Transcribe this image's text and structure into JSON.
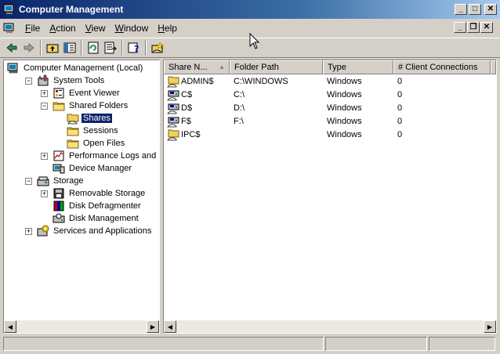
{
  "window": {
    "title": "Computer Management",
    "buttons": {
      "minimize": "_",
      "maximize": "□",
      "close": "✕"
    },
    "mdi_buttons": {
      "minimize": "_",
      "restore": "❐",
      "close": "✕"
    }
  },
  "menu": [
    {
      "label": "File",
      "key": "F",
      "rest": "ile"
    },
    {
      "label": "Action",
      "key": "A",
      "rest": "ction"
    },
    {
      "label": "View",
      "key": "V",
      "rest": "iew"
    },
    {
      "label": "Window",
      "key": "W",
      "rest": "indow"
    },
    {
      "label": "Help",
      "key": "H",
      "rest": "elp"
    }
  ],
  "tree": [
    {
      "label": "Computer Management (Local)",
      "icon": "computer-icon",
      "level": 0,
      "expander": ""
    },
    {
      "label": "System Tools",
      "icon": "system-tools-icon",
      "level": 1,
      "expander": "−"
    },
    {
      "label": "Event Viewer",
      "icon": "event-viewer-icon",
      "level": 2,
      "expander": "+"
    },
    {
      "label": "Shared Folders",
      "icon": "folder-icon",
      "level": 2,
      "expander": "−"
    },
    {
      "label": "Shares",
      "icon": "shares-icon",
      "level": 3,
      "expander": "",
      "selected": true
    },
    {
      "label": "Sessions",
      "icon": "folder-icon",
      "level": 3,
      "expander": ""
    },
    {
      "label": "Open Files",
      "icon": "folder-icon",
      "level": 3,
      "expander": ""
    },
    {
      "label": "Performance Logs and Alerts",
      "icon": "performance-icon",
      "level": 2,
      "expander": "+"
    },
    {
      "label": "Device Manager",
      "icon": "device-manager-icon",
      "level": 2,
      "expander": ""
    },
    {
      "label": "Storage",
      "icon": "storage-icon",
      "level": 1,
      "expander": "−"
    },
    {
      "label": "Removable Storage",
      "icon": "removable-storage-icon",
      "level": 2,
      "expander": "+"
    },
    {
      "label": "Disk Defragmenter",
      "icon": "defrag-icon",
      "level": 2,
      "expander": ""
    },
    {
      "label": "Disk Management",
      "icon": "disk-management-icon",
      "level": 2,
      "expander": ""
    },
    {
      "label": "Services and Applications",
      "icon": "services-icon",
      "level": 1,
      "expander": "+"
    }
  ],
  "list": {
    "columns": [
      "Share N...",
      "Folder Path",
      "Type",
      "# Client Connections"
    ],
    "sort_arrow": "▲",
    "rows": [
      {
        "name": "ADMIN$",
        "path": "C:\\WINDOWS",
        "type": "Windows",
        "connections": "0",
        "icon": "share-folder-icon"
      },
      {
        "name": "C$",
        "path": "C:\\",
        "type": "Windows",
        "connections": "0",
        "icon": "share-drive-icon"
      },
      {
        "name": "D$",
        "path": "D:\\",
        "type": "Windows",
        "connections": "0",
        "icon": "share-drive-icon"
      },
      {
        "name": "F$",
        "path": "F:\\",
        "type": "Windows",
        "connections": "0",
        "icon": "share-drive-icon"
      },
      {
        "name": "IPC$",
        "path": "",
        "type": "Windows",
        "connections": "0",
        "icon": "share-folder-icon"
      }
    ]
  },
  "scroll": {
    "left_arrow": "◀",
    "right_arrow": "▶"
  },
  "colors": {
    "titlebar_start": "#0a246a",
    "titlebar_end": "#a6caf0",
    "face": "#d4d0c8",
    "selection": "#0a246a"
  }
}
